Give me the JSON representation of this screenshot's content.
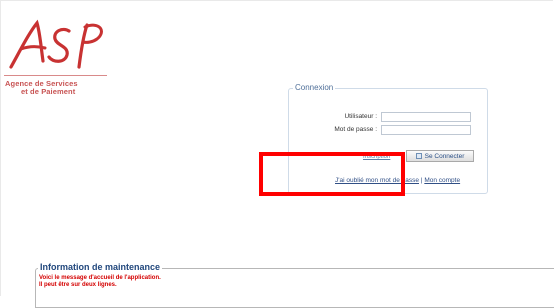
{
  "logo": {
    "text": "ASP",
    "tagline_line1": "Agence de Services",
    "tagline_line2": "et de Paiement"
  },
  "login": {
    "legend": "Connexion",
    "user_label": "Utilisateur :",
    "password_label": "Mot de passe :",
    "small_link": "Inscription",
    "connect_button": "Se Connecter",
    "forgot_password": "J'ai oublié mon mot de passe",
    "separator": "|",
    "account_link": "Mon compte"
  },
  "maintenance": {
    "legend": "Information de maintenance",
    "line1": "Voici le message d'accueil de l'application.",
    "line2": "Il peut être sur deux lignes."
  },
  "colors": {
    "brand_red": "#c83232",
    "legend_blue": "#4f6f99",
    "highlight_red": "#ff0000",
    "maintenance_title": "#22487d"
  },
  "icons": {
    "connect_button_icon": "login-icon"
  }
}
